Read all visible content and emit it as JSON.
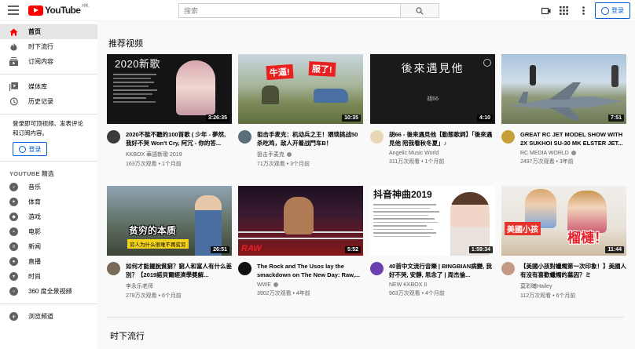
{
  "header": {
    "logo_text": "YouTube",
    "region": "HK",
    "search_placeholder": "搜索",
    "signin_label": "登录"
  },
  "sidebar": {
    "nav": [
      {
        "label": "首页",
        "icon": "home-icon",
        "active": true
      },
      {
        "label": "时下流行",
        "icon": "flame-icon",
        "active": false
      },
      {
        "label": "订阅内容",
        "icon": "subscriptions-icon",
        "active": false
      }
    ],
    "library": [
      {
        "label": "媒体库",
        "icon": "library-icon"
      },
      {
        "label": "历史记录",
        "icon": "history-icon"
      }
    ],
    "signin_text": "登录即可顶视频、发表评论和订阅内容。",
    "signin_label": "登录",
    "section_title": "YOUTUBE 精选",
    "best": [
      {
        "label": "音乐",
        "icon": "music-icon"
      },
      {
        "label": "体育",
        "icon": "sports-icon"
      },
      {
        "label": "游戏",
        "icon": "gaming-icon"
      },
      {
        "label": "电影",
        "icon": "movies-icon"
      },
      {
        "label": "新闻",
        "icon": "news-icon"
      },
      {
        "label": "直播",
        "icon": "live-icon"
      },
      {
        "label": "时尚",
        "icon": "fashion-icon"
      },
      {
        "label": "360 度全景视频",
        "icon": "360-video-icon"
      }
    ],
    "browse_label": "浏览频道"
  },
  "main": {
    "recommended_title": "推荐视频",
    "trending_title": "时下流行",
    "videos": [
      {
        "title": "2020不能不聽的100首歌 ( 少年 - 夢然, 我好不哭 Won't Cry, 阿冗 - 你的答...",
        "channel": "KKBOX 華語新歌 2019",
        "verified": false,
        "stats": "163万次观看 • 1个月前",
        "duration": "3:26:35",
        "thumb_text": "2020新歌",
        "avatar_color": "#3b3b3b"
      },
      {
        "title": "狙击手麦克：机动兵之王！猥琐挑战50杀吃鸡，敌人开着战鬥车B！",
        "channel": "狙击手麦克",
        "verified": true,
        "stats": "71万次观看 • 3个月前",
        "duration": "10:35",
        "thumb_text_a": "牛逼!",
        "thumb_text_b": "服了!",
        "avatar_color": "#5a6e7a"
      },
      {
        "title": "胡66 - 後來遇見他【動態歌詞】「後來遇見他 陪我看秋冬夏」♪",
        "channel": "Angelic Music World",
        "verified": false,
        "stats": "311万次观看 • 1个月前",
        "duration": "4:10",
        "thumb_text": "後來遇見他",
        "thumb_sub": "胡66",
        "avatar_color": "#e8d8b8"
      },
      {
        "title": "GREAT RC JET MODEL SHOW WITH 2X SUKHOI SU-30 MK ELSTER JET...",
        "channel": "RC MEDIA WORLD",
        "verified": true,
        "stats": "2497万次观看 • 3年前",
        "duration": "7:51",
        "avatar_color": "#c7a03a"
      },
      {
        "title": "如何才能擺脫貧窮？窮人和富人有什么差別？【2019諾貝爾經濟學獎解...",
        "channel": "李永乐老师",
        "verified": false,
        "stats": "278万次观看 • 6个月前",
        "duration": "26:51",
        "thumb_text": "贫穷的本质",
        "thumb_sub": "穷人为什么很难不再贫穷",
        "avatar_color": "#7a6a5a"
      },
      {
        "title": "The Rock and The Usos lay the smackdown on The New Day: Raw,...",
        "channel": "WWE",
        "verified": true,
        "stats": "3902万次观看 • 4年前",
        "duration": "5:52",
        "thumb_text": "RAW",
        "avatar_color": "#111111"
      },
      {
        "title": "40首中文流行音樂 | BINGBIAN病變, 我好不哭, 安靜, 思念了 | 周杰倫...",
        "channel": "NEW KKBOX II",
        "verified": false,
        "stats": "963万次观看 • 4个月前",
        "duration": "1:59:34",
        "thumb_text": "抖音神曲2019",
        "avatar_color": "#6c3fb0"
      },
      {
        "title": "【美國小孩對蠟燭第一次印象！】美國人有沒有喜歡蠟燭的墓因？ミ",
        "channel": "莫彩曦Hailey",
        "verified": false,
        "stats": "112万次观看 • 6个月前",
        "duration": "11:44",
        "thumb_text_a": "美國小孩",
        "thumb_text_b": "榴槤！",
        "avatar_color": "#c49a86"
      }
    ]
  }
}
